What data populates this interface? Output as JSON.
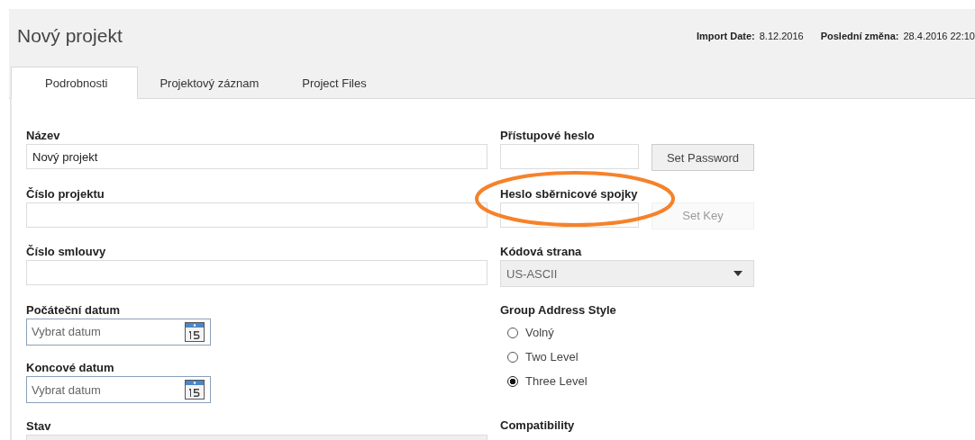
{
  "header": {
    "title": "Nový projekt",
    "meta": [
      {
        "label": "Import Date:",
        "value": "8.12.2016"
      },
      {
        "label": "Poslední změna:",
        "value": "28.4.2016 22:10"
      }
    ]
  },
  "tabs": [
    {
      "label": "Podrobnosti",
      "selected": true
    },
    {
      "label": "Projektový záznam",
      "selected": false
    },
    {
      "label": "Project Files",
      "selected": false
    }
  ],
  "left_fields": [
    {
      "label": "Název",
      "kind": "text",
      "value": "Nový projekt"
    },
    {
      "label": "Číslo projektu",
      "kind": "text"
    },
    {
      "label": "Číslo smlouvy",
      "kind": "text"
    },
    {
      "label": "Počáteční datum",
      "kind": "date",
      "placeholder": "Vybrat datum"
    },
    {
      "label": "Koncové datum",
      "kind": "date",
      "placeholder": "Vybrat datum"
    },
    {
      "label": "Stav",
      "kind": "select"
    }
  ],
  "right_fields": [
    {
      "label": "Přístupové heslo",
      "kind": "password",
      "button": {
        "label": "Set Password",
        "disabled": false
      }
    },
    {
      "label": "Heslo sběrnicové spojky",
      "kind": "password",
      "button": {
        "label": "Set Key",
        "disabled": true
      }
    },
    {
      "label": "Kódová strana",
      "kind": "select",
      "value": "US-ASCII",
      "disabled": true
    },
    {
      "label": "Group Address Style",
      "kind": "radio",
      "options": [
        {
          "label": "Volný",
          "selected": false
        },
        {
          "label": "Two Level",
          "selected": false
        },
        {
          "label": "Three Level",
          "selected": true
        }
      ]
    },
    {
      "label": "Compatibility",
      "kind": "heading"
    }
  ]
}
